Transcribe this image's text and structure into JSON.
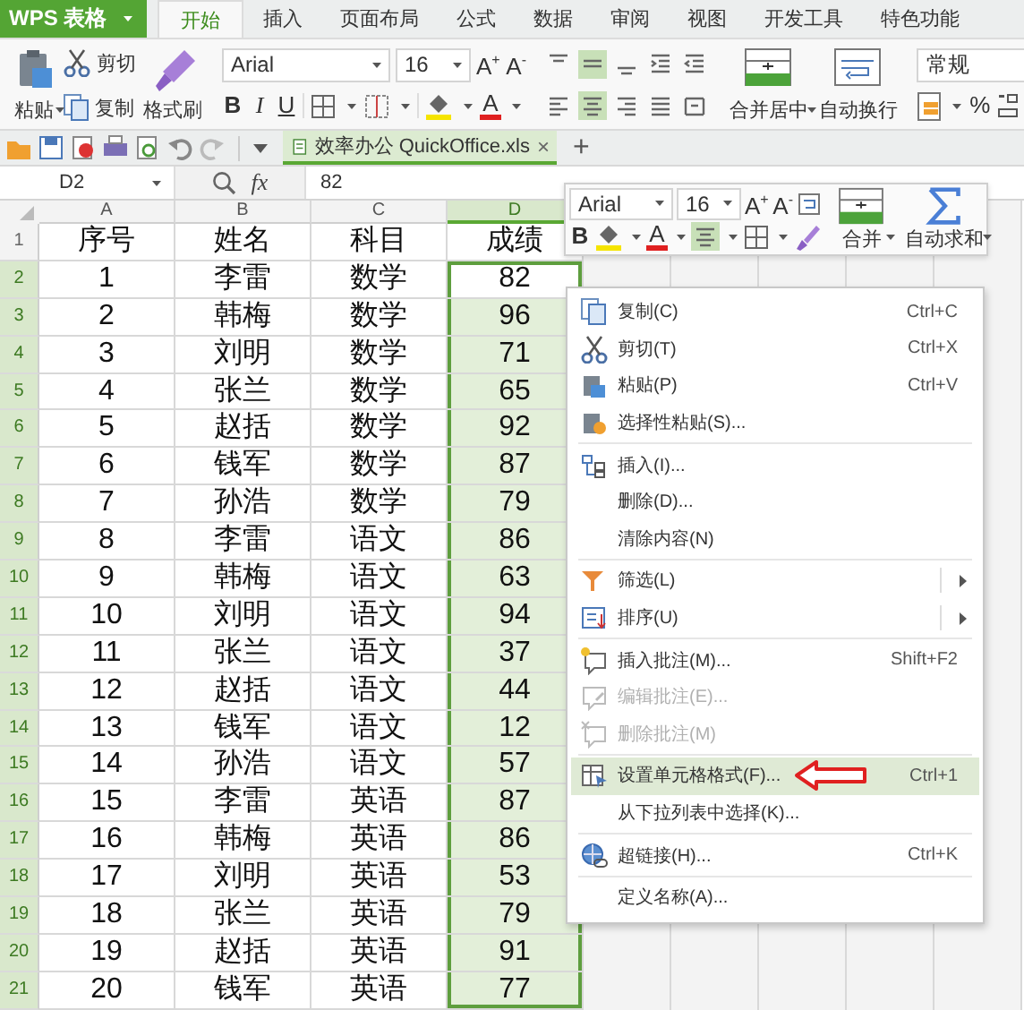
{
  "app_bar": {
    "logo": "WPS 表格",
    "tabs": [
      {
        "label": "开始",
        "selected": true
      },
      {
        "label": "插入",
        "selected": false
      },
      {
        "label": "页面布局",
        "selected": false
      },
      {
        "label": "公式",
        "selected": false
      },
      {
        "label": "数据",
        "selected": false
      },
      {
        "label": "审阅",
        "selected": false
      },
      {
        "label": "视图",
        "selected": false
      },
      {
        "label": "开发工具",
        "selected": false
      },
      {
        "label": "特色功能",
        "selected": false
      }
    ]
  },
  "ribbon": {
    "paste": "粘贴",
    "cut": "剪切",
    "copy": "复制",
    "format_painter": "格式刷",
    "font": "Arial",
    "font_size": "16",
    "grow_font": "A$^{+}$",
    "shrink_font": "A$^{-}$",
    "bold": "B",
    "italic": "I",
    "underline": "U",
    "font_color": "A",
    "align_buttons": [
      {
        "selected": false
      },
      {
        "selected": true
      },
      {
        "selected": false
      },
      {
        "selected": false
      },
      {
        "selected": false
      },
      {
        "selected": false
      },
      {
        "selected": true
      },
      {
        "selected": false
      },
      {
        "selected": false
      },
      {
        "selected": false
      }
    ],
    "merge": "合并居中",
    "wrap": "自动换行",
    "number_format": "常规",
    "percent": "%"
  },
  "document_tab": {
    "title": "效率办公 QuickOffice.xls",
    "close": "×",
    "selected": true
  },
  "new_tab": "+",
  "formula_bar": {
    "name_box": "D2",
    "fx": "fx",
    "value": "82"
  },
  "sheet": {
    "columns": [
      {
        "label": "A",
        "selected": false
      },
      {
        "label": "B",
        "selected": false
      },
      {
        "label": "C",
        "selected": false
      },
      {
        "label": "D",
        "selected": true
      }
    ],
    "rows": [
      {
        "number": "1",
        "selected": false,
        "active": false,
        "cells": [
          "序号",
          "姓名",
          "科目",
          "成绩"
        ]
      },
      {
        "number": "2",
        "selected": true,
        "active": true,
        "cells": [
          "1",
          "李雷",
          "数学",
          "82"
        ]
      },
      {
        "number": "3",
        "selected": true,
        "active": false,
        "cells": [
          "2",
          "韩梅",
          "数学",
          "96"
        ]
      },
      {
        "number": "4",
        "selected": true,
        "active": false,
        "cells": [
          "3",
          "刘明",
          "数学",
          "71"
        ]
      },
      {
        "number": "5",
        "selected": true,
        "active": false,
        "cells": [
          "4",
          "张兰",
          "数学",
          "65"
        ]
      },
      {
        "number": "6",
        "selected": true,
        "active": false,
        "cells": [
          "5",
          "赵括",
          "数学",
          "92"
        ]
      },
      {
        "number": "7",
        "selected": true,
        "active": false,
        "cells": [
          "6",
          "钱军",
          "数学",
          "87"
        ]
      },
      {
        "number": "8",
        "selected": true,
        "active": false,
        "cells": [
          "7",
          "孙浩",
          "数学",
          "79"
        ]
      },
      {
        "number": "9",
        "selected": true,
        "active": false,
        "cells": [
          "8",
          "李雷",
          "语文",
          "86"
        ]
      },
      {
        "number": "10",
        "selected": true,
        "active": false,
        "cells": [
          "9",
          "韩梅",
          "语文",
          "63"
        ]
      },
      {
        "number": "11",
        "selected": true,
        "active": false,
        "cells": [
          "10",
          "刘明",
          "语文",
          "94"
        ]
      },
      {
        "number": "12",
        "selected": true,
        "active": false,
        "cells": [
          "11",
          "张兰",
          "语文",
          "37"
        ]
      },
      {
        "number": "13",
        "selected": true,
        "active": false,
        "cells": [
          "12",
          "赵括",
          "语文",
          "44"
        ]
      },
      {
        "number": "14",
        "selected": true,
        "active": false,
        "cells": [
          "13",
          "钱军",
          "语文",
          "12"
        ]
      },
      {
        "number": "15",
        "selected": true,
        "active": false,
        "cells": [
          "14",
          "孙浩",
          "语文",
          "57"
        ]
      },
      {
        "number": "16",
        "selected": true,
        "active": false,
        "cells": [
          "15",
          "李雷",
          "英语",
          "87"
        ]
      },
      {
        "number": "17",
        "selected": true,
        "active": false,
        "cells": [
          "16",
          "韩梅",
          "英语",
          "86"
        ]
      },
      {
        "number": "18",
        "selected": true,
        "active": false,
        "cells": [
          "17",
          "刘明",
          "英语",
          "53"
        ]
      },
      {
        "number": "19",
        "selected": true,
        "active": false,
        "cells": [
          "18",
          "张兰",
          "英语",
          "79"
        ]
      },
      {
        "number": "20",
        "selected": true,
        "active": false,
        "cells": [
          "19",
          "赵括",
          "英语",
          "91"
        ]
      },
      {
        "number": "21",
        "selected": true,
        "active": false,
        "cells": [
          "20",
          "钱军",
          "英语",
          "77"
        ]
      }
    ]
  },
  "mini_toolbar": {
    "font": "Arial",
    "font_size": "16",
    "grow_font": "A$^{+}$",
    "shrink_font": "A$^{-}$",
    "bold": "B",
    "font_color": "A",
    "align": {
      "selected": true
    },
    "merge": "合并",
    "autosum": "自动求和"
  },
  "context_menu": {
    "items": [
      {
        "kind": "item",
        "label": "复制(C)",
        "shortcut": "Ctrl+C",
        "disabled": false,
        "selected": false
      },
      {
        "kind": "item",
        "label": "剪切(T)",
        "shortcut": "Ctrl+X",
        "disabled": false,
        "selected": false
      },
      {
        "kind": "item",
        "label": "粘贴(P)",
        "shortcut": "Ctrl+V",
        "disabled": false,
        "selected": false
      },
      {
        "kind": "item",
        "label": "选择性粘贴(S)...",
        "disabled": false,
        "selected": false
      },
      {
        "kind": "separator"
      },
      {
        "kind": "item",
        "label": "插入(I)...",
        "disabled": false,
        "selected": false
      },
      {
        "kind": "item",
        "label": "删除(D)...",
        "disabled": false,
        "selected": false
      },
      {
        "kind": "item",
        "label": "清除内容(N)",
        "disabled": false,
        "selected": false
      },
      {
        "kind": "separator"
      },
      {
        "kind": "submenu",
        "label": "筛选(L)",
        "disabled": false,
        "selected": false
      },
      {
        "kind": "submenu",
        "label": "排序(U)",
        "disabled": false,
        "selected": false
      },
      {
        "kind": "separator"
      },
      {
        "kind": "item",
        "label": "插入批注(M)...",
        "shortcut": "Shift+F2",
        "disabled": false,
        "selected": false
      },
      {
        "kind": "item",
        "label": "编辑批注(E)...",
        "disabled": true,
        "selected": false
      },
      {
        "kind": "item",
        "label": "删除批注(M)",
        "disabled": true,
        "selected": false
      },
      {
        "kind": "separator"
      },
      {
        "kind": "item",
        "label": "设置单元格格式(F)...",
        "shortcut": "Ctrl+1",
        "disabled": false,
        "selected": true
      },
      {
        "kind": "item",
        "label": "从下拉列表中选择(K)...",
        "disabled": false,
        "selected": false
      },
      {
        "kind": "separator"
      },
      {
        "kind": "item",
        "label": "超链接(H)...",
        "shortcut": "Ctrl+K",
        "disabled": false,
        "selected": false
      },
      {
        "kind": "separator"
      },
      {
        "kind": "item",
        "label": "定义名称(A)...",
        "disabled": false,
        "selected": false
      }
    ]
  }
}
